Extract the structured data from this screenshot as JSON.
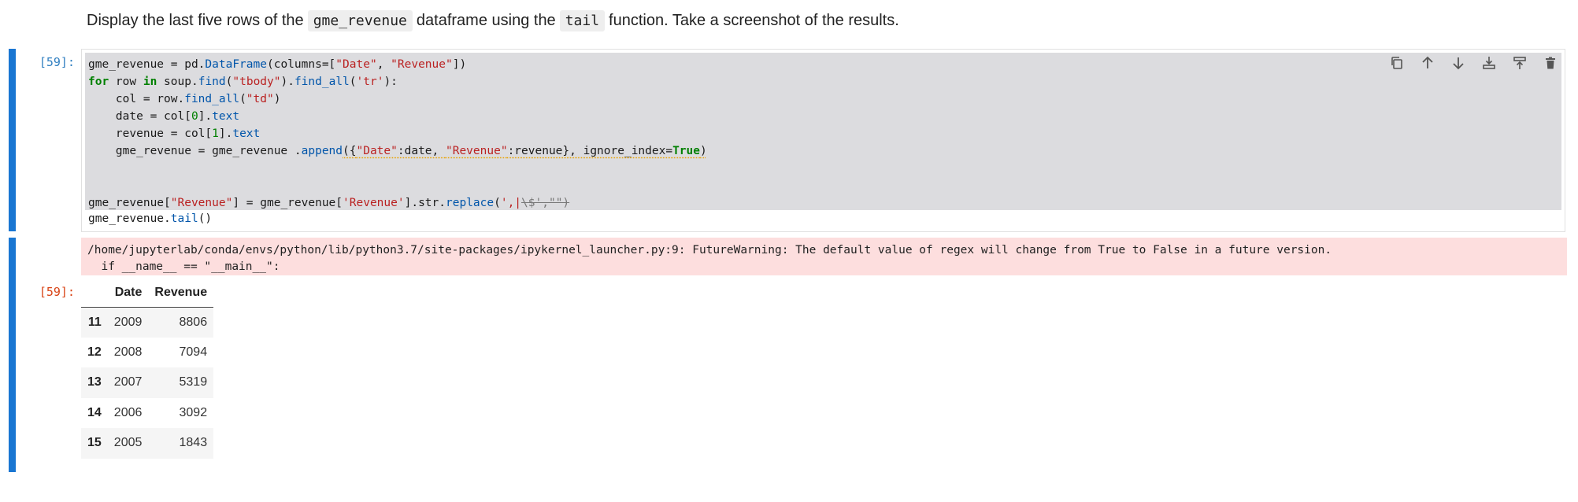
{
  "markdown": {
    "text_before": "Display the last five rows of the",
    "code1": "gme_revenue",
    "text_mid": "dataframe using the",
    "code2": "tail",
    "text_after": "function. Take a screenshot of the results."
  },
  "code_cell": {
    "prompt": "[59]:",
    "lines": {
      "l1": {
        "a": "gme_revenue = pd.",
        "b": "DataFrame",
        "c": "(columns=[",
        "d": "\"Date\"",
        "e": ", ",
        "f": "\"Revenue\"",
        "g": "])"
      },
      "l2": {
        "a": "for",
        "b": " row ",
        "c": "in",
        "d": " soup.",
        "e": "find",
        "f": "(",
        "g": "\"tbody\"",
        "h": ").",
        "i": "find_all",
        "j": "(",
        "k": "'tr'",
        "l": "):"
      },
      "l3": {
        "a": "    col = row.",
        "b": "find_all",
        "c": "(",
        "d": "\"td\"",
        "e": ")"
      },
      "l4": {
        "a": "    date = col[",
        "b": "0",
        "c": "].",
        "d": "text"
      },
      "l5": {
        "a": "    revenue = col[",
        "b": "1",
        "c": "].",
        "d": "text"
      },
      "l6": {
        "a": "    gme_revenue = gme_revenue .",
        "b": "append",
        "c": "({",
        "d": "\"Date\"",
        "e": ":date, ",
        "f": "\"Revenue\"",
        "g": ":revenue}, ignore_index=",
        "h": "True",
        "i": ")"
      },
      "l7": {
        "a": "gme_revenue[",
        "b": "\"Revenue\"",
        "c": "] = gme_revenue[",
        "d": "'Revenue'",
        "e": "].str.",
        "f": "replace",
        "g": "(",
        "h": "',|",
        "i": "\\$',\"\")"
      },
      "l8": {
        "a": "gme_revenue.",
        "b": "tail",
        "c": "()"
      }
    }
  },
  "toolbar": {
    "buttons": [
      "copy-icon",
      "arrow-up-icon",
      "arrow-down-icon",
      "insert-below-icon",
      "insert-above-icon",
      "delete-icon"
    ]
  },
  "output": {
    "prompt": "[59]:",
    "stderr_line1": "/home/jupyterlab/conda/envs/python/lib/python3.7/site-packages/ipykernel_launcher.py:9: FutureWarning: The default value of regex will change from True to False in a future version.",
    "stderr_line2": "  if __name__ == \"__main__\":",
    "table": {
      "columns": [
        "Date",
        "Revenue"
      ],
      "rows": [
        {
          "index": "11",
          "date": "2009",
          "revenue": "8806"
        },
        {
          "index": "12",
          "date": "2008",
          "revenue": "7094"
        },
        {
          "index": "13",
          "date": "2007",
          "revenue": "5319"
        },
        {
          "index": "14",
          "date": "2006",
          "revenue": "3092"
        },
        {
          "index": "15",
          "date": "2005",
          "revenue": "1843"
        }
      ]
    }
  },
  "colors": {
    "collapser": "#1976d2",
    "code_bg": "#dcdcdf",
    "stderr_bg": "#fddede",
    "prompt_in": "#307fc1",
    "prompt_out": "#d84315"
  }
}
